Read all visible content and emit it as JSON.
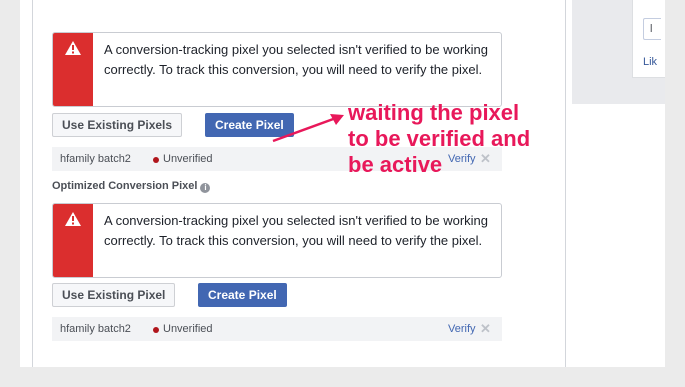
{
  "alerts": [
    {
      "message": "A conversion-tracking pixel you selected isn't verified to be working correctly. To track this conversion, you will need to verify the pixel."
    },
    {
      "message": "A conversion-tracking pixel you selected isn't verified to be working correctly. To track this conversion, you will need to verify the pixel."
    }
  ],
  "buttons": {
    "use_existing": "Use Existing Pixels",
    "use_existing_2": "Use Existing Pixel",
    "create": "Create Pixel"
  },
  "pixel_rows": [
    {
      "name": "hfamily batch2",
      "status": "Unverified",
      "verify": "Verify",
      "remove": "✕"
    },
    {
      "name": "hfamily batch2",
      "status": "Unverified",
      "verify": "Verify",
      "remove": "✕"
    }
  ],
  "optimized_label": "Optimized Conversion Pixel",
  "info_glyph": "i",
  "annotation": {
    "lines": [
      "waiting the pixel",
      "to be verified and",
      "be active"
    ],
    "color": "#e8185a"
  },
  "right_panel": {
    "button_glyph": "l",
    "like_text": "Lik"
  },
  "colors": {
    "alert_red": "#db2e2e",
    "button_blue": "#4267b2",
    "unverified_dot": "#b0151b"
  }
}
